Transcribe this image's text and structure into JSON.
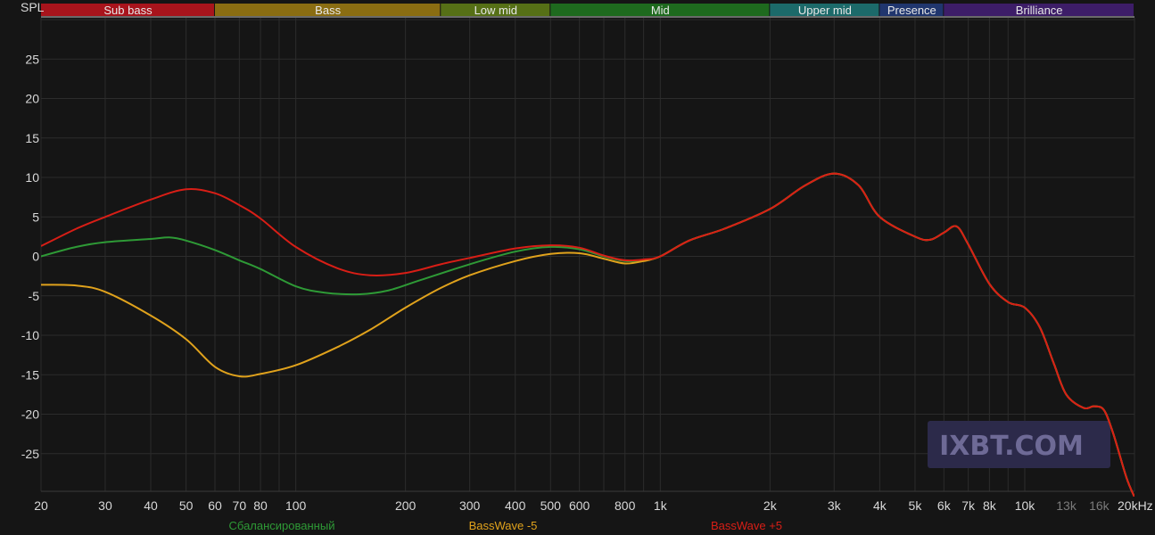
{
  "chart_data": {
    "type": "line",
    "ylabel": "SPL",
    "ylim": [
      -30,
      30
    ],
    "y_ticks": [
      25,
      20,
      15,
      10,
      5,
      0,
      -5,
      -10,
      -15,
      -20,
      -25
    ],
    "x_scale": "log",
    "xlim": [
      20,
      20000
    ],
    "x_ticks": [
      {
        "value": 20,
        "label": "20"
      },
      {
        "value": 30,
        "label": "30"
      },
      {
        "value": 40,
        "label": "40"
      },
      {
        "value": 50,
        "label": "50"
      },
      {
        "value": 60,
        "label": "60"
      },
      {
        "value": 70,
        "label": "70"
      },
      {
        "value": 80,
        "label": "80"
      },
      {
        "value": 100,
        "label": "100"
      },
      {
        "value": 200,
        "label": "200"
      },
      {
        "value": 300,
        "label": "300"
      },
      {
        "value": 400,
        "label": "400"
      },
      {
        "value": 500,
        "label": "500"
      },
      {
        "value": 600,
        "label": "600"
      },
      {
        "value": 800,
        "label": "800"
      },
      {
        "value": 1000,
        "label": "1k"
      },
      {
        "value": 2000,
        "label": "2k"
      },
      {
        "value": 3000,
        "label": "3k"
      },
      {
        "value": 4000,
        "label": "4k"
      },
      {
        "value": 5000,
        "label": "5k"
      },
      {
        "value": 6000,
        "label": "6k"
      },
      {
        "value": 7000,
        "label": "7k"
      },
      {
        "value": 8000,
        "label": "8k"
      },
      {
        "value": 10000,
        "label": "10k"
      },
      {
        "value": 13000,
        "label": "13k",
        "dim": true
      },
      {
        "value": 16000,
        "label": "16k",
        "dim": true
      },
      {
        "value": 20000,
        "label": "20kHz"
      }
    ],
    "bands": [
      {
        "label": "Sub bass",
        "from": 20,
        "to": 60,
        "color": "#a8141c"
      },
      {
        "label": "Bass",
        "from": 60,
        "to": 250,
        "color": "#8a6d12"
      },
      {
        "label": "Low mid",
        "from": 250,
        "to": 500,
        "color": "#567016"
      },
      {
        "label": "Mid",
        "from": 500,
        "to": 2000,
        "color": "#1e6a1e"
      },
      {
        "label": "Upper mid",
        "from": 2000,
        "to": 4000,
        "color": "#1c6a6a"
      },
      {
        "label": "Presence",
        "from": 4000,
        "to": 6000,
        "color": "#20366e"
      },
      {
        "label": "Brilliance",
        "from": 6000,
        "to": 20000,
        "color": "#3d1d68"
      }
    ],
    "series": [
      {
        "name": "Сбалансированный",
        "color": "#2e9a36",
        "points": [
          [
            20,
            0
          ],
          [
            25,
            1.2
          ],
          [
            30,
            1.8
          ],
          [
            40,
            2.2
          ],
          [
            45,
            2.4
          ],
          [
            50,
            2.0
          ],
          [
            60,
            0.8
          ],
          [
            70,
            -0.5
          ],
          [
            80,
            -1.6
          ],
          [
            100,
            -3.8
          ],
          [
            120,
            -4.6
          ],
          [
            150,
            -4.8
          ],
          [
            180,
            -4.3
          ],
          [
            220,
            -3.0
          ],
          [
            300,
            -1.0
          ],
          [
            400,
            0.6
          ],
          [
            500,
            1.2
          ],
          [
            600,
            0.9
          ],
          [
            700,
            0
          ],
          [
            800,
            -0.6
          ],
          [
            900,
            -0.5
          ],
          [
            1000,
            0
          ],
          [
            1200,
            2.0
          ],
          [
            1500,
            3.5
          ],
          [
            2000,
            6.0
          ],
          [
            2500,
            9.0
          ],
          [
            3000,
            10.5
          ],
          [
            3500,
            9.0
          ],
          [
            4000,
            5.0
          ],
          [
            5000,
            2.5
          ],
          [
            5500,
            2.1
          ],
          [
            6000,
            3.0
          ],
          [
            6500,
            3.8
          ],
          [
            7000,
            1.5
          ],
          [
            8000,
            -3.5
          ],
          [
            9000,
            -5.8
          ],
          [
            10000,
            -6.5
          ],
          [
            11000,
            -9.0
          ],
          [
            12000,
            -13.5
          ],
          [
            13000,
            -17.5
          ],
          [
            14500,
            -19.2
          ],
          [
            15500,
            -19.0
          ],
          [
            16500,
            -19.5
          ],
          [
            17500,
            -22.5
          ],
          [
            19000,
            -28.0
          ],
          [
            20000,
            -30.5
          ]
        ]
      },
      {
        "name": "BassWave -5",
        "color": "#e0a21c",
        "points": [
          [
            20,
            -3.6
          ],
          [
            25,
            -3.7
          ],
          [
            30,
            -4.5
          ],
          [
            40,
            -7.5
          ],
          [
            50,
            -10.5
          ],
          [
            60,
            -14.0
          ],
          [
            70,
            -15.2
          ],
          [
            80,
            -14.9
          ],
          [
            100,
            -13.8
          ],
          [
            130,
            -11.5
          ],
          [
            160,
            -9.3
          ],
          [
            200,
            -6.5
          ],
          [
            250,
            -4.0
          ],
          [
            300,
            -2.4
          ],
          [
            400,
            -0.6
          ],
          [
            500,
            0.3
          ],
          [
            600,
            0.4
          ],
          [
            700,
            -0.3
          ],
          [
            800,
            -0.9
          ],
          [
            900,
            -0.6
          ],
          [
            1000,
            0
          ],
          [
            1200,
            2.0
          ],
          [
            1500,
            3.5
          ],
          [
            2000,
            6.0
          ],
          [
            2500,
            9.0
          ],
          [
            3000,
            10.5
          ],
          [
            3500,
            9.0
          ],
          [
            4000,
            5.0
          ],
          [
            5000,
            2.5
          ],
          [
            5500,
            2.1
          ],
          [
            6000,
            3.0
          ],
          [
            6500,
            3.8
          ],
          [
            7000,
            1.5
          ],
          [
            8000,
            -3.5
          ],
          [
            9000,
            -5.8
          ],
          [
            10000,
            -6.5
          ],
          [
            11000,
            -9.0
          ],
          [
            12000,
            -13.5
          ],
          [
            13000,
            -17.5
          ],
          [
            14500,
            -19.2
          ],
          [
            15500,
            -19.0
          ],
          [
            16500,
            -19.5
          ],
          [
            17500,
            -22.5
          ],
          [
            19000,
            -28.0
          ],
          [
            20000,
            -30.5
          ]
        ]
      },
      {
        "name": "BassWave +5",
        "color": "#d81e16",
        "points": [
          [
            20,
            1.3
          ],
          [
            25,
            3.5
          ],
          [
            30,
            5.0
          ],
          [
            40,
            7.2
          ],
          [
            50,
            8.5
          ],
          [
            60,
            8.0
          ],
          [
            70,
            6.5
          ],
          [
            80,
            4.8
          ],
          [
            100,
            1.2
          ],
          [
            130,
            -1.5
          ],
          [
            160,
            -2.4
          ],
          [
            200,
            -2.1
          ],
          [
            250,
            -1.0
          ],
          [
            300,
            -0.2
          ],
          [
            400,
            1.0
          ],
          [
            500,
            1.4
          ],
          [
            600,
            1.1
          ],
          [
            700,
            0.1
          ],
          [
            800,
            -0.5
          ],
          [
            900,
            -0.4
          ],
          [
            1000,
            0
          ],
          [
            1200,
            2.0
          ],
          [
            1500,
            3.5
          ],
          [
            2000,
            6.0
          ],
          [
            2500,
            9.0
          ],
          [
            3000,
            10.5
          ],
          [
            3500,
            9.0
          ],
          [
            4000,
            5.0
          ],
          [
            5000,
            2.5
          ],
          [
            5500,
            2.1
          ],
          [
            6000,
            3.0
          ],
          [
            6500,
            3.8
          ],
          [
            7000,
            1.5
          ],
          [
            8000,
            -3.5
          ],
          [
            9000,
            -5.8
          ],
          [
            10000,
            -6.5
          ],
          [
            11000,
            -9.0
          ],
          [
            12000,
            -13.5
          ],
          [
            13000,
            -17.5
          ],
          [
            14500,
            -19.2
          ],
          [
            15500,
            -19.0
          ],
          [
            16500,
            -19.5
          ],
          [
            17500,
            -22.5
          ],
          [
            19000,
            -28.0
          ],
          [
            20000,
            -30.5
          ]
        ]
      }
    ],
    "grid": true,
    "legend": "bottom"
  },
  "watermark": "IXBT.COM",
  "colors": {
    "background": "#151515",
    "grid": "#2c2c2c",
    "watermark_bg": "#2c2a4a"
  }
}
